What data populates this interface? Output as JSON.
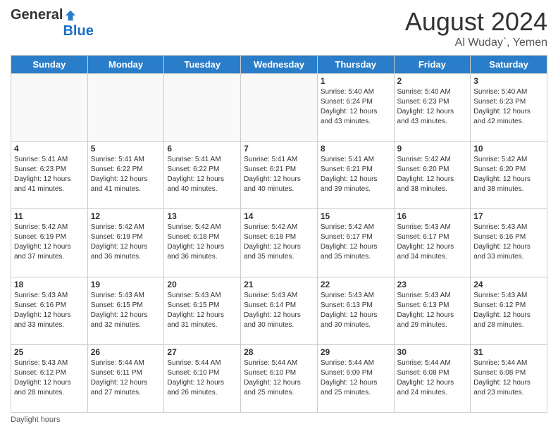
{
  "header": {
    "logo_general": "General",
    "logo_blue": "Blue",
    "month_year": "August 2024",
    "location": "Al Wuday`, Yemen"
  },
  "days_of_week": [
    "Sunday",
    "Monday",
    "Tuesday",
    "Wednesday",
    "Thursday",
    "Friday",
    "Saturday"
  ],
  "weeks": [
    [
      {
        "day": "",
        "info": ""
      },
      {
        "day": "",
        "info": ""
      },
      {
        "day": "",
        "info": ""
      },
      {
        "day": "",
        "info": ""
      },
      {
        "day": "1",
        "info": "Sunrise: 5:40 AM\nSunset: 6:24 PM\nDaylight: 12 hours and 43 minutes."
      },
      {
        "day": "2",
        "info": "Sunrise: 5:40 AM\nSunset: 6:23 PM\nDaylight: 12 hours and 43 minutes."
      },
      {
        "day": "3",
        "info": "Sunrise: 5:40 AM\nSunset: 6:23 PM\nDaylight: 12 hours and 42 minutes."
      }
    ],
    [
      {
        "day": "4",
        "info": "Sunrise: 5:41 AM\nSunset: 6:23 PM\nDaylight: 12 hours and 41 minutes."
      },
      {
        "day": "5",
        "info": "Sunrise: 5:41 AM\nSunset: 6:22 PM\nDaylight: 12 hours and 41 minutes."
      },
      {
        "day": "6",
        "info": "Sunrise: 5:41 AM\nSunset: 6:22 PM\nDaylight: 12 hours and 40 minutes."
      },
      {
        "day": "7",
        "info": "Sunrise: 5:41 AM\nSunset: 6:21 PM\nDaylight: 12 hours and 40 minutes."
      },
      {
        "day": "8",
        "info": "Sunrise: 5:41 AM\nSunset: 6:21 PM\nDaylight: 12 hours and 39 minutes."
      },
      {
        "day": "9",
        "info": "Sunrise: 5:42 AM\nSunset: 6:20 PM\nDaylight: 12 hours and 38 minutes."
      },
      {
        "day": "10",
        "info": "Sunrise: 5:42 AM\nSunset: 6:20 PM\nDaylight: 12 hours and 38 minutes."
      }
    ],
    [
      {
        "day": "11",
        "info": "Sunrise: 5:42 AM\nSunset: 6:19 PM\nDaylight: 12 hours and 37 minutes."
      },
      {
        "day": "12",
        "info": "Sunrise: 5:42 AM\nSunset: 6:19 PM\nDaylight: 12 hours and 36 minutes."
      },
      {
        "day": "13",
        "info": "Sunrise: 5:42 AM\nSunset: 6:18 PM\nDaylight: 12 hours and 36 minutes."
      },
      {
        "day": "14",
        "info": "Sunrise: 5:42 AM\nSunset: 6:18 PM\nDaylight: 12 hours and 35 minutes."
      },
      {
        "day": "15",
        "info": "Sunrise: 5:42 AM\nSunset: 6:17 PM\nDaylight: 12 hours and 35 minutes."
      },
      {
        "day": "16",
        "info": "Sunrise: 5:43 AM\nSunset: 6:17 PM\nDaylight: 12 hours and 34 minutes."
      },
      {
        "day": "17",
        "info": "Sunrise: 5:43 AM\nSunset: 6:16 PM\nDaylight: 12 hours and 33 minutes."
      }
    ],
    [
      {
        "day": "18",
        "info": "Sunrise: 5:43 AM\nSunset: 6:16 PM\nDaylight: 12 hours and 33 minutes."
      },
      {
        "day": "19",
        "info": "Sunrise: 5:43 AM\nSunset: 6:15 PM\nDaylight: 12 hours and 32 minutes."
      },
      {
        "day": "20",
        "info": "Sunrise: 5:43 AM\nSunset: 6:15 PM\nDaylight: 12 hours and 31 minutes."
      },
      {
        "day": "21",
        "info": "Sunrise: 5:43 AM\nSunset: 6:14 PM\nDaylight: 12 hours and 30 minutes."
      },
      {
        "day": "22",
        "info": "Sunrise: 5:43 AM\nSunset: 6:13 PM\nDaylight: 12 hours and 30 minutes."
      },
      {
        "day": "23",
        "info": "Sunrise: 5:43 AM\nSunset: 6:13 PM\nDaylight: 12 hours and 29 minutes."
      },
      {
        "day": "24",
        "info": "Sunrise: 5:43 AM\nSunset: 6:12 PM\nDaylight: 12 hours and 28 minutes."
      }
    ],
    [
      {
        "day": "25",
        "info": "Sunrise: 5:43 AM\nSunset: 6:12 PM\nDaylight: 12 hours and 28 minutes."
      },
      {
        "day": "26",
        "info": "Sunrise: 5:44 AM\nSunset: 6:11 PM\nDaylight: 12 hours and 27 minutes."
      },
      {
        "day": "27",
        "info": "Sunrise: 5:44 AM\nSunset: 6:10 PM\nDaylight: 12 hours and 26 minutes."
      },
      {
        "day": "28",
        "info": "Sunrise: 5:44 AM\nSunset: 6:10 PM\nDaylight: 12 hours and 25 minutes."
      },
      {
        "day": "29",
        "info": "Sunrise: 5:44 AM\nSunset: 6:09 PM\nDaylight: 12 hours and 25 minutes."
      },
      {
        "day": "30",
        "info": "Sunrise: 5:44 AM\nSunset: 6:08 PM\nDaylight: 12 hours and 24 minutes."
      },
      {
        "day": "31",
        "info": "Sunrise: 5:44 AM\nSunset: 6:08 PM\nDaylight: 12 hours and 23 minutes."
      }
    ]
  ],
  "footer": {
    "note": "Daylight hours"
  }
}
